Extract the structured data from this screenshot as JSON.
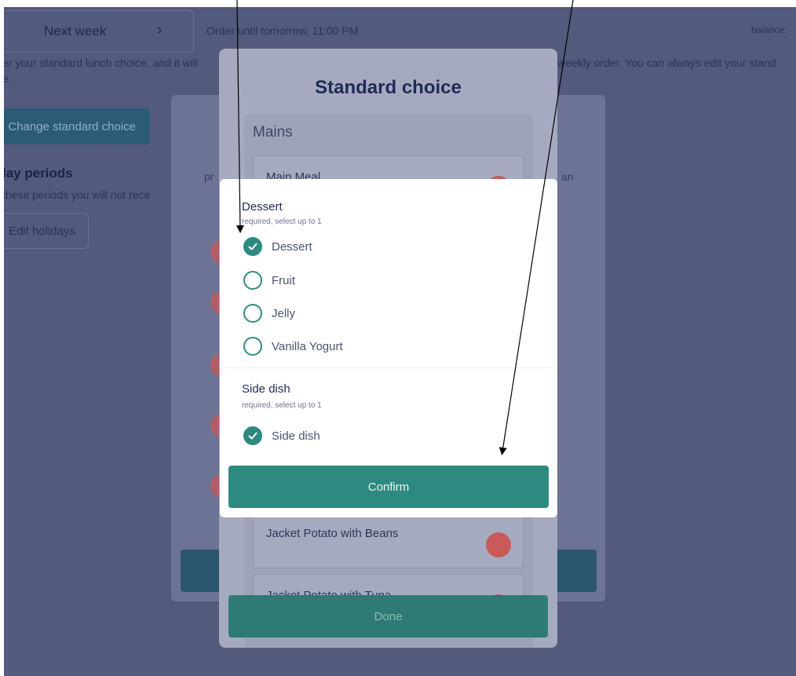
{
  "header": {
    "week_label": "Next week",
    "order_until": "Order until tomorrow, 11:00 PM",
    "balance": "balance:"
  },
  "intro": {
    "text_left": "er your standard lunch choice, and it will",
    "text_left_line2": "e.",
    "text_right": "weekly order. You can always edit your stand"
  },
  "standard_choice": {
    "change_button": "Change standard choice"
  },
  "holidays": {
    "title": "lay periods",
    "description": "these periods you will not rece",
    "edit_button": "Edit holidays"
  },
  "middle_card": {
    "left_fragment": "pr",
    "right_fragment": "an"
  },
  "standard_modal": {
    "title": "Standard choice",
    "mains_label": "Mains",
    "meals": [
      {
        "name": "Main Meal"
      },
      {
        "name": "Jacket Potato with Beans"
      },
      {
        "name": "Jacket Potato with Tuna"
      }
    ],
    "done_button": "Done"
  },
  "option_modal": {
    "groups": [
      {
        "title": "Dessert",
        "subtitle": "required, select up to 1",
        "options": [
          {
            "label": "Dessert",
            "checked": true
          },
          {
            "label": "Fruit",
            "checked": false
          },
          {
            "label": "Jelly",
            "checked": false
          },
          {
            "label": "Vanilla Yogurt",
            "checked": false
          }
        ]
      },
      {
        "title": "Side dish",
        "subtitle": "required, select up to 1",
        "options": [
          {
            "label": "Side dish",
            "checked": true
          }
        ]
      }
    ],
    "confirm_button": "Confirm"
  },
  "colors": {
    "overlay": "#535a7c",
    "accent_teal": "#2e8a80",
    "navy": "#1f2b55",
    "red_dot": "#c85a5a"
  }
}
